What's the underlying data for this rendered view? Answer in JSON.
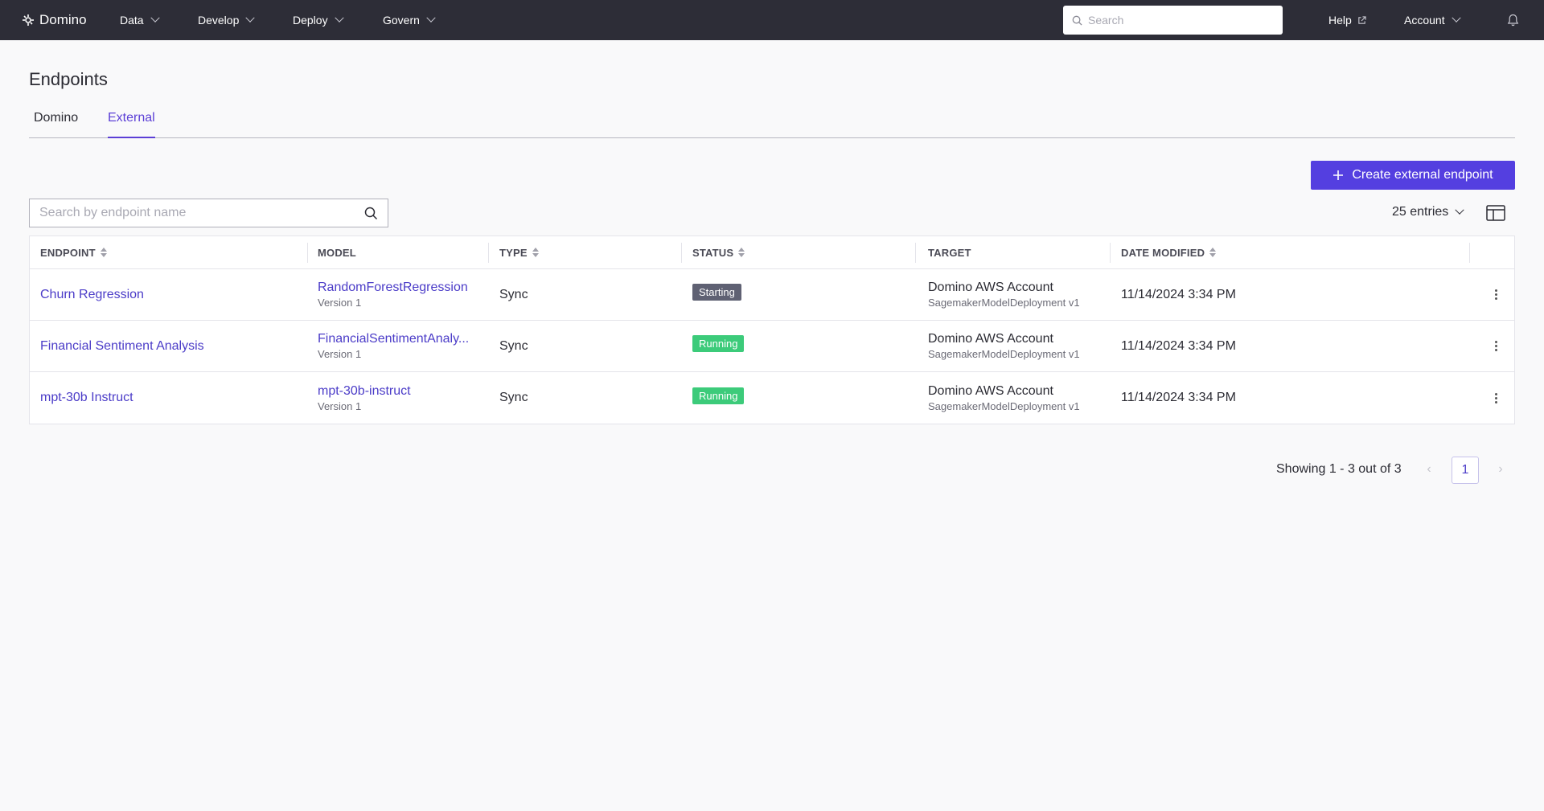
{
  "nav": {
    "brand": "Domino",
    "items": [
      "Data",
      "Develop",
      "Deploy",
      "Govern"
    ],
    "search_placeholder": "Search",
    "help": "Help",
    "account": "Account"
  },
  "page": {
    "title": "Endpoints",
    "tabs": [
      "Domino",
      "External"
    ],
    "active_tab": "External",
    "create_button": "Create external endpoint",
    "search_placeholder": "Search by endpoint name",
    "entries": "25 entries"
  },
  "table": {
    "headers": {
      "endpoint": "ENDPOINT",
      "model": "MODEL",
      "type": "TYPE",
      "status": "STATUS",
      "target": "TARGET",
      "date_modified": "DATE MODIFIED"
    },
    "rows": [
      {
        "endpoint": "Churn Regression",
        "model": "RandomForestRegression",
        "model_version": "Version 1",
        "type": "Sync",
        "status": "Starting",
        "status_color": "#5f6173",
        "target": "Domino AWS Account",
        "target_sub": "SagemakerModelDeployment v1",
        "date_modified": "11/14/2024 3:34 PM"
      },
      {
        "endpoint": "Financial Sentiment Analysis",
        "model": "FinancialSentimentAnaly...",
        "model_version": "Version 1",
        "type": "Sync",
        "status": "Running",
        "status_color": "#3ccb7a",
        "target": "Domino AWS Account",
        "target_sub": "SagemakerModelDeployment v1",
        "date_modified": "11/14/2024 3:34 PM"
      },
      {
        "endpoint": "mpt-30b Instruct",
        "model": "mpt-30b-instruct",
        "model_version": "Version 1",
        "type": "Sync",
        "status": "Running",
        "status_color": "#3ccb7a",
        "target": "Domino AWS Account",
        "target_sub": "SagemakerModelDeployment v1",
        "date_modified": "11/14/2024 3:34 PM"
      }
    ]
  },
  "pagination": {
    "showing": "Showing 1 - 3 out of 3",
    "current_page": "1"
  },
  "colors": {
    "accent": "#543fe0",
    "nav_bg": "#2d2d37",
    "link": "#4b3cc8"
  }
}
